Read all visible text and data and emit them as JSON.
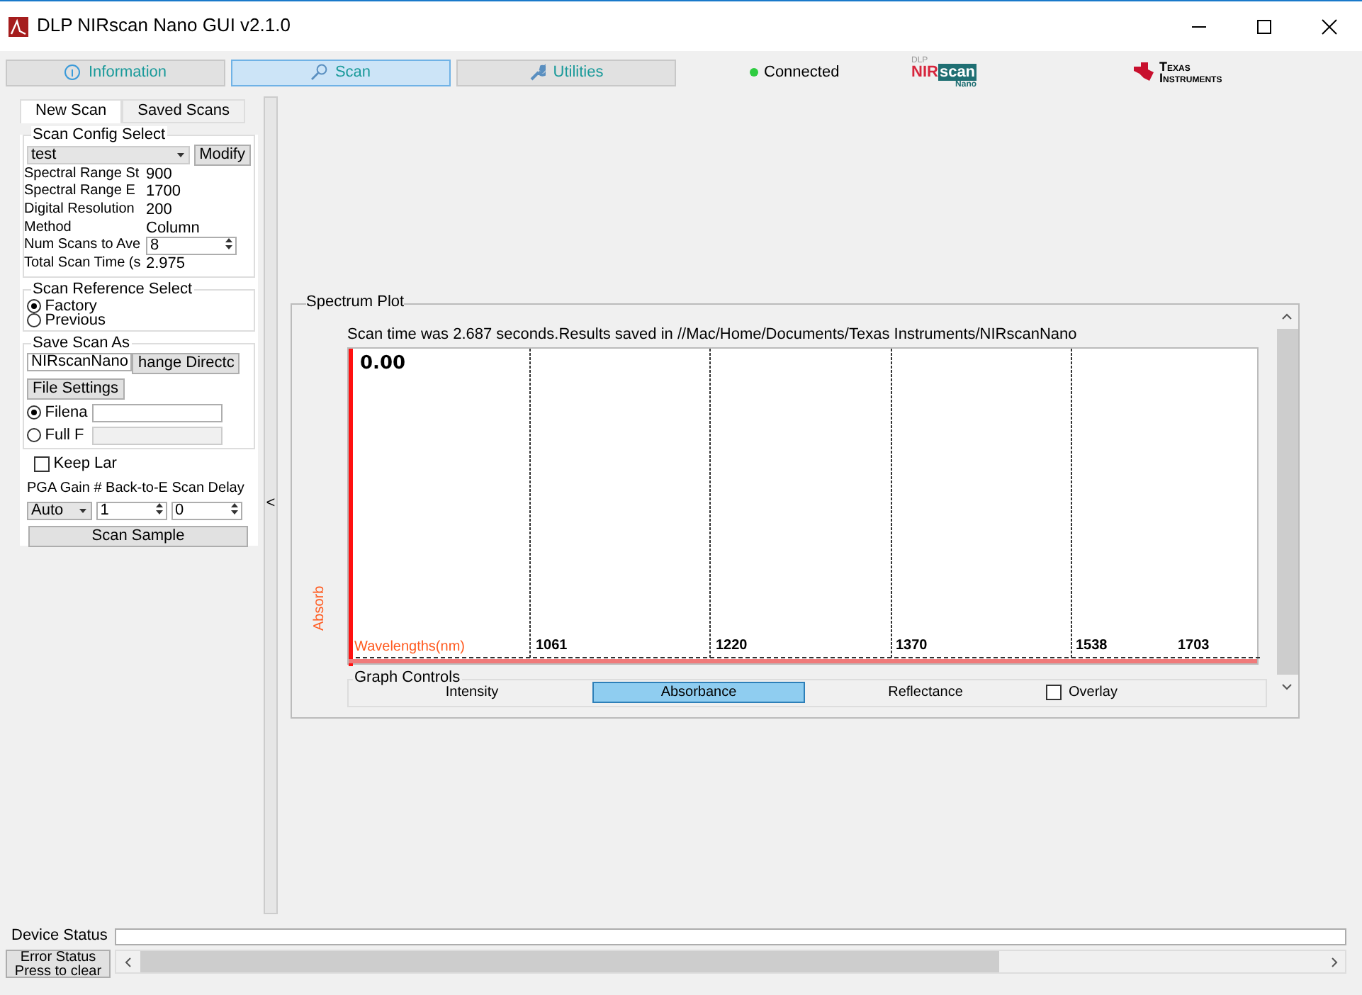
{
  "window": {
    "title": "DLP NIRscan Nano GUI v2.1.0"
  },
  "main_tabs": [
    {
      "label": "Information",
      "selected": false,
      "kind": "info"
    },
    {
      "label": "Scan",
      "selected": true,
      "kind": "search"
    },
    {
      "label": "Utilities",
      "selected": false,
      "kind": "wrench"
    }
  ],
  "connection": {
    "label": "Connected",
    "connected": true
  },
  "nirscan_logo": {
    "top": "DLP",
    "main_a": "NIR",
    "main_b": "scan",
    "sub": "Nano"
  },
  "ti_logo": {
    "line1": "Texas",
    "line2": "Instruments"
  },
  "left_tabs": [
    {
      "label": "New Scan",
      "selected": true
    },
    {
      "label": "Saved Scans",
      "selected": false
    }
  ],
  "scan_config": {
    "title": "Scan Config Select",
    "selected_config": "test",
    "modify_button": "Modify",
    "rows": [
      {
        "label": "Spectral Range St",
        "value": "900",
        "kind": "text"
      },
      {
        "label": "Spectral Range E",
        "value": "1700",
        "kind": "text"
      },
      {
        "label": "Digital Resolution",
        "value": "200",
        "kind": "text"
      },
      {
        "label": "Method",
        "value": "Column",
        "kind": "text"
      },
      {
        "label": "Num Scans to Ave",
        "value": "8",
        "kind": "spin"
      },
      {
        "label": "Total Scan Time (s",
        "value": "2.975",
        "kind": "text"
      }
    ]
  },
  "scan_reference": {
    "title": "Scan Reference Select",
    "options": [
      {
        "label": "Factory",
        "selected": true
      },
      {
        "label": "Previous",
        "selected": false
      }
    ]
  },
  "save_scan": {
    "title": "Save Scan As",
    "name_value": "NIRscanNano",
    "change_dir_button": "hange Directc",
    "file_settings_button": "File Settings",
    "options": [
      {
        "label": "Filena",
        "selected": true,
        "field_enabled": true
      },
      {
        "label": "Full F",
        "selected": false,
        "field_enabled": false
      }
    ]
  },
  "keep_lamp": {
    "label": "Keep Lar",
    "checked": false
  },
  "acquisition": {
    "labels": [
      "PGA Gain",
      "# Back-to-E",
      "Scan Delay"
    ],
    "pga_gain": "Auto",
    "back_to_back": "1",
    "scan_delay": "0"
  },
  "scan_button": "Scan Sample",
  "splitter_toggle": "<",
  "spectrum_plot": {
    "title": "Spectrum Plot",
    "message": "Scan time was 2.687 seconds.Results saved in //Mac/Home/Documents/Texas Instruments/NIRscanNano",
    "y_axis_label": "Absorb",
    "x_axis_label": "Wavelengths(nm)",
    "y_tick": "0.00",
    "x_ticks": [
      "1061",
      "1220",
      "1370",
      "1538",
      "1703"
    ],
    "graph_controls": {
      "title": "Graph Controls",
      "modes": [
        {
          "label": "Intensity",
          "selected": false
        },
        {
          "label": "Absorbance",
          "selected": true
        },
        {
          "label": "Reflectance",
          "selected": false
        }
      ],
      "overlay": {
        "label": "Overlay",
        "checked": false
      }
    }
  },
  "status": {
    "device_status_label": "Device Status",
    "error_button": [
      "Error Status",
      "Press to clear"
    ]
  }
}
